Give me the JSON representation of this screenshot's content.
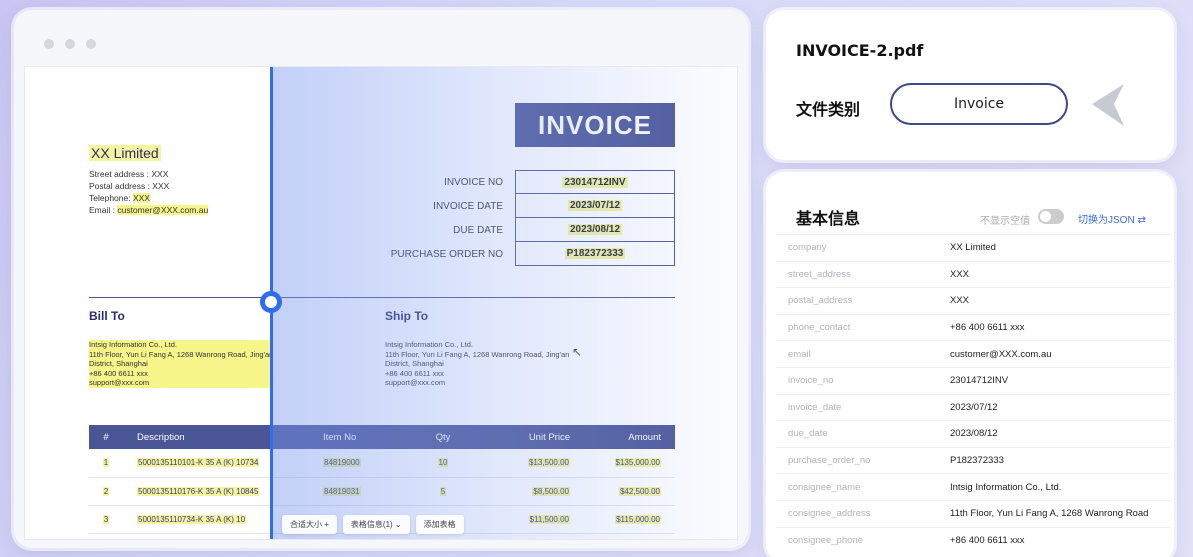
{
  "document": {
    "seller": {
      "company": "XX Limited",
      "street_line": "Street address : XXX",
      "postal_line": "Postal address : XXX",
      "telephone_label": "Telephone: ",
      "telephone_value": "XXX",
      "email_label": "Email : ",
      "email_value": "customer@XXX.com.au"
    },
    "title": "INVOICE",
    "fields": [
      {
        "label": "INVOICE NO",
        "value": "23014712INV"
      },
      {
        "label": "INVOICE DATE",
        "value": "2023/07/12"
      },
      {
        "label": "DUE DATE",
        "value": "2023/08/12"
      },
      {
        "label": "PURCHASE ORDER NO",
        "value": "P182372333"
      }
    ],
    "bill_to": {
      "heading": "Bill To",
      "lines": [
        "Intsig Information Co., Ltd.",
        "11th Floor, Yun Li Fang A, 1268 Wanrong Road, Jing'an",
        "District, Shanghai",
        "+86 400 6611 xxx",
        "support@xxx.com"
      ]
    },
    "ship_to": {
      "heading": "Ship To",
      "lines": [
        "Intsig Information Co., Ltd.",
        "11th Floor, Yun Li Fang A, 1268 Wanrong Road, Jing'an",
        "District, Shanghai",
        "+86 400 6611 xxx",
        "support@xxx.com"
      ]
    },
    "table": {
      "headers": [
        "#",
        "Description",
        "Item No",
        "Qty",
        "Unit Price",
        "Amount"
      ],
      "rows": [
        [
          "1",
          "5000135110101-K 35 A (K) 10734",
          "84819000",
          "10",
          "$13,500.00",
          "$135,000.00"
        ],
        [
          "2",
          "5000135110176-K 35 A (K) 10845",
          "84819031",
          "5",
          "$8,500.00",
          "$42,500.00"
        ],
        [
          "3",
          "5000135110734-K 35 A (K) 10",
          "",
          "",
          "$11,500.00",
          "$115,000.00"
        ]
      ]
    },
    "toolbar": {
      "fit_label": "合适大小",
      "plus": "+",
      "table_info": "表格信息(1)",
      "add_table": "添加表格"
    }
  },
  "file_card": {
    "filename": "INVOICE-2.pdf",
    "type_label": "文件类别",
    "type_value": "Invoice"
  },
  "info_card": {
    "title": "基本信息",
    "hide_empty_label": "不显示空值",
    "switch_json_label": "切换为JSON ⇄",
    "fields": [
      {
        "key": "company",
        "value": "XX Limited"
      },
      {
        "key": "street_address",
        "value": "XXX"
      },
      {
        "key": "postal_address",
        "value": "XXX"
      },
      {
        "key": "phone_contact",
        "value": "+86 400 6611 xxx"
      },
      {
        "key": "email",
        "value": "customer@XXX.com.au"
      },
      {
        "key": "invoice_no",
        "value": "23014712INV"
      },
      {
        "key": "invoice_date",
        "value": "2023/07/12"
      },
      {
        "key": "due_date",
        "value": "2023/08/12"
      },
      {
        "key": "purchase_order_no",
        "value": "P182372333"
      },
      {
        "key": "consignee_name",
        "value": "Intsig Information Co., Ltd."
      },
      {
        "key": "consignee_address",
        "value": "11th Floor, Yun Li Fang A, 1268 Wanrong Road"
      },
      {
        "key": "consignee_phone",
        "value": "+86 400 6611 xxx"
      }
    ]
  },
  "colors": {
    "accent": "#2f6df0",
    "invoice_navy": "#4a5596",
    "highlight": "#f3f3a0",
    "link": "#3a6ee8"
  }
}
